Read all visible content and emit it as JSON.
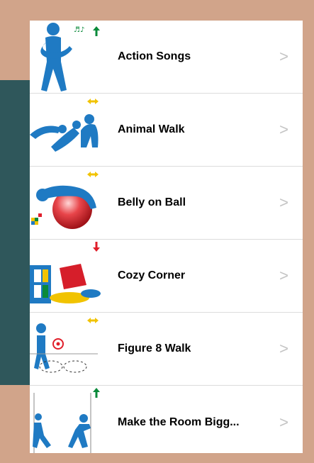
{
  "colors": {
    "frame": "#d1a48a",
    "side_panel": "#2f575b",
    "figure_blue": "#1f7ac3",
    "arrow_green": "#0a8a3a",
    "arrow_yellow": "#f1c300",
    "arrow_red": "#e01e2a",
    "chevron": "#c4c4c4"
  },
  "activities": [
    {
      "label": "Action Songs",
      "icon": "singing-person-icon",
      "indicator": "up-arrow-green-icon"
    },
    {
      "label": "Animal Walk",
      "icon": "animal-walk-figures-icon",
      "indicator": "left-right-arrow-yellow-icon"
    },
    {
      "label": "Belly on Ball",
      "icon": "belly-on-ball-icon",
      "indicator": "left-right-arrow-yellow-icon"
    },
    {
      "label": "Cozy Corner",
      "icon": "cozy-corner-pillows-icon",
      "indicator": "down-arrow-red-icon"
    },
    {
      "label": "Figure 8 Walk",
      "icon": "figure-eight-walk-icon",
      "indicator": "left-right-arrow-yellow-icon"
    },
    {
      "label": "Make the Room Bigg...",
      "icon": "push-walls-icon",
      "indicator": "up-arrow-green-icon"
    }
  ],
  "chevron_glyph": ">"
}
